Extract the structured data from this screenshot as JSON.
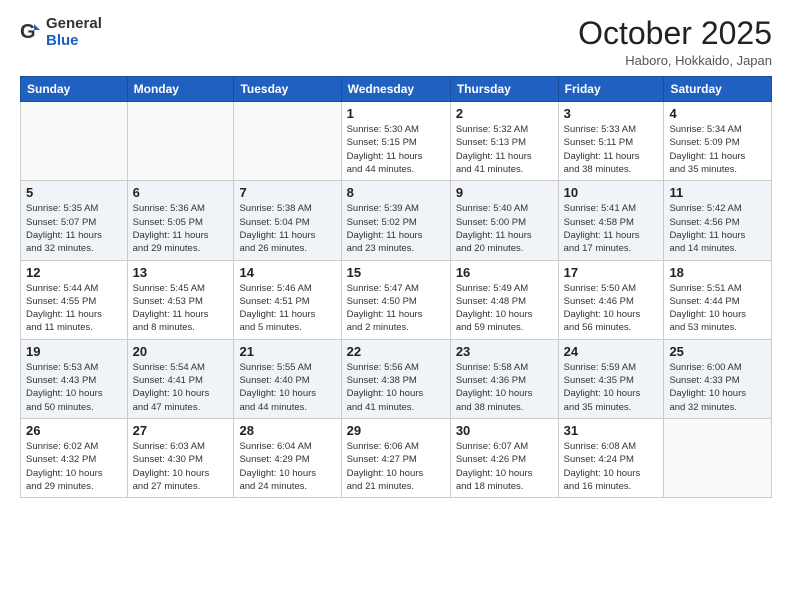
{
  "header": {
    "logo_general": "General",
    "logo_blue": "Blue",
    "month_title": "October 2025",
    "location": "Haboro, Hokkaido, Japan"
  },
  "weekdays": [
    "Sunday",
    "Monday",
    "Tuesday",
    "Wednesday",
    "Thursday",
    "Friday",
    "Saturday"
  ],
  "weeks": [
    [
      {
        "day": "",
        "info": ""
      },
      {
        "day": "",
        "info": ""
      },
      {
        "day": "",
        "info": ""
      },
      {
        "day": "1",
        "info": "Sunrise: 5:30 AM\nSunset: 5:15 PM\nDaylight: 11 hours\nand 44 minutes."
      },
      {
        "day": "2",
        "info": "Sunrise: 5:32 AM\nSunset: 5:13 PM\nDaylight: 11 hours\nand 41 minutes."
      },
      {
        "day": "3",
        "info": "Sunrise: 5:33 AM\nSunset: 5:11 PM\nDaylight: 11 hours\nand 38 minutes."
      },
      {
        "day": "4",
        "info": "Sunrise: 5:34 AM\nSunset: 5:09 PM\nDaylight: 11 hours\nand 35 minutes."
      }
    ],
    [
      {
        "day": "5",
        "info": "Sunrise: 5:35 AM\nSunset: 5:07 PM\nDaylight: 11 hours\nand 32 minutes."
      },
      {
        "day": "6",
        "info": "Sunrise: 5:36 AM\nSunset: 5:05 PM\nDaylight: 11 hours\nand 29 minutes."
      },
      {
        "day": "7",
        "info": "Sunrise: 5:38 AM\nSunset: 5:04 PM\nDaylight: 11 hours\nand 26 minutes."
      },
      {
        "day": "8",
        "info": "Sunrise: 5:39 AM\nSunset: 5:02 PM\nDaylight: 11 hours\nand 23 minutes."
      },
      {
        "day": "9",
        "info": "Sunrise: 5:40 AM\nSunset: 5:00 PM\nDaylight: 11 hours\nand 20 minutes."
      },
      {
        "day": "10",
        "info": "Sunrise: 5:41 AM\nSunset: 4:58 PM\nDaylight: 11 hours\nand 17 minutes."
      },
      {
        "day": "11",
        "info": "Sunrise: 5:42 AM\nSunset: 4:56 PM\nDaylight: 11 hours\nand 14 minutes."
      }
    ],
    [
      {
        "day": "12",
        "info": "Sunrise: 5:44 AM\nSunset: 4:55 PM\nDaylight: 11 hours\nand 11 minutes."
      },
      {
        "day": "13",
        "info": "Sunrise: 5:45 AM\nSunset: 4:53 PM\nDaylight: 11 hours\nand 8 minutes."
      },
      {
        "day": "14",
        "info": "Sunrise: 5:46 AM\nSunset: 4:51 PM\nDaylight: 11 hours\nand 5 minutes."
      },
      {
        "day": "15",
        "info": "Sunrise: 5:47 AM\nSunset: 4:50 PM\nDaylight: 11 hours\nand 2 minutes."
      },
      {
        "day": "16",
        "info": "Sunrise: 5:49 AM\nSunset: 4:48 PM\nDaylight: 10 hours\nand 59 minutes."
      },
      {
        "day": "17",
        "info": "Sunrise: 5:50 AM\nSunset: 4:46 PM\nDaylight: 10 hours\nand 56 minutes."
      },
      {
        "day": "18",
        "info": "Sunrise: 5:51 AM\nSunset: 4:44 PM\nDaylight: 10 hours\nand 53 minutes."
      }
    ],
    [
      {
        "day": "19",
        "info": "Sunrise: 5:53 AM\nSunset: 4:43 PM\nDaylight: 10 hours\nand 50 minutes."
      },
      {
        "day": "20",
        "info": "Sunrise: 5:54 AM\nSunset: 4:41 PM\nDaylight: 10 hours\nand 47 minutes."
      },
      {
        "day": "21",
        "info": "Sunrise: 5:55 AM\nSunset: 4:40 PM\nDaylight: 10 hours\nand 44 minutes."
      },
      {
        "day": "22",
        "info": "Sunrise: 5:56 AM\nSunset: 4:38 PM\nDaylight: 10 hours\nand 41 minutes."
      },
      {
        "day": "23",
        "info": "Sunrise: 5:58 AM\nSunset: 4:36 PM\nDaylight: 10 hours\nand 38 minutes."
      },
      {
        "day": "24",
        "info": "Sunrise: 5:59 AM\nSunset: 4:35 PM\nDaylight: 10 hours\nand 35 minutes."
      },
      {
        "day": "25",
        "info": "Sunrise: 6:00 AM\nSunset: 4:33 PM\nDaylight: 10 hours\nand 32 minutes."
      }
    ],
    [
      {
        "day": "26",
        "info": "Sunrise: 6:02 AM\nSunset: 4:32 PM\nDaylight: 10 hours\nand 29 minutes."
      },
      {
        "day": "27",
        "info": "Sunrise: 6:03 AM\nSunset: 4:30 PM\nDaylight: 10 hours\nand 27 minutes."
      },
      {
        "day": "28",
        "info": "Sunrise: 6:04 AM\nSunset: 4:29 PM\nDaylight: 10 hours\nand 24 minutes."
      },
      {
        "day": "29",
        "info": "Sunrise: 6:06 AM\nSunset: 4:27 PM\nDaylight: 10 hours\nand 21 minutes."
      },
      {
        "day": "30",
        "info": "Sunrise: 6:07 AM\nSunset: 4:26 PM\nDaylight: 10 hours\nand 18 minutes."
      },
      {
        "day": "31",
        "info": "Sunrise: 6:08 AM\nSunset: 4:24 PM\nDaylight: 10 hours\nand 16 minutes."
      },
      {
        "day": "",
        "info": ""
      }
    ]
  ]
}
